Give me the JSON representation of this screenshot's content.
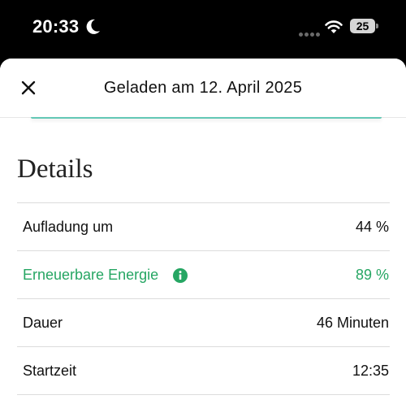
{
  "status_bar": {
    "time": "20:33",
    "battery": "25",
    "icons": [
      "moon-icon",
      "signal-dots-icon",
      "wifi-icon",
      "battery-icon"
    ]
  },
  "header": {
    "close_icon": "close-icon",
    "title": "Geladen am 12. April 2025"
  },
  "details": {
    "title": "Details",
    "rows": [
      {
        "label": "Aufladung um",
        "value": "44 %"
      },
      {
        "label": "Erneuerbare Energie",
        "value": "89 %",
        "icon": "info-icon"
      },
      {
        "label": "Dauer",
        "value": "46 Minuten"
      },
      {
        "label": "Startzeit",
        "value": "12:35"
      }
    ]
  },
  "colors": {
    "renewable_green": "#26a663",
    "teal_accent": "#63c8b5",
    "divider": "#dcdcdc"
  }
}
